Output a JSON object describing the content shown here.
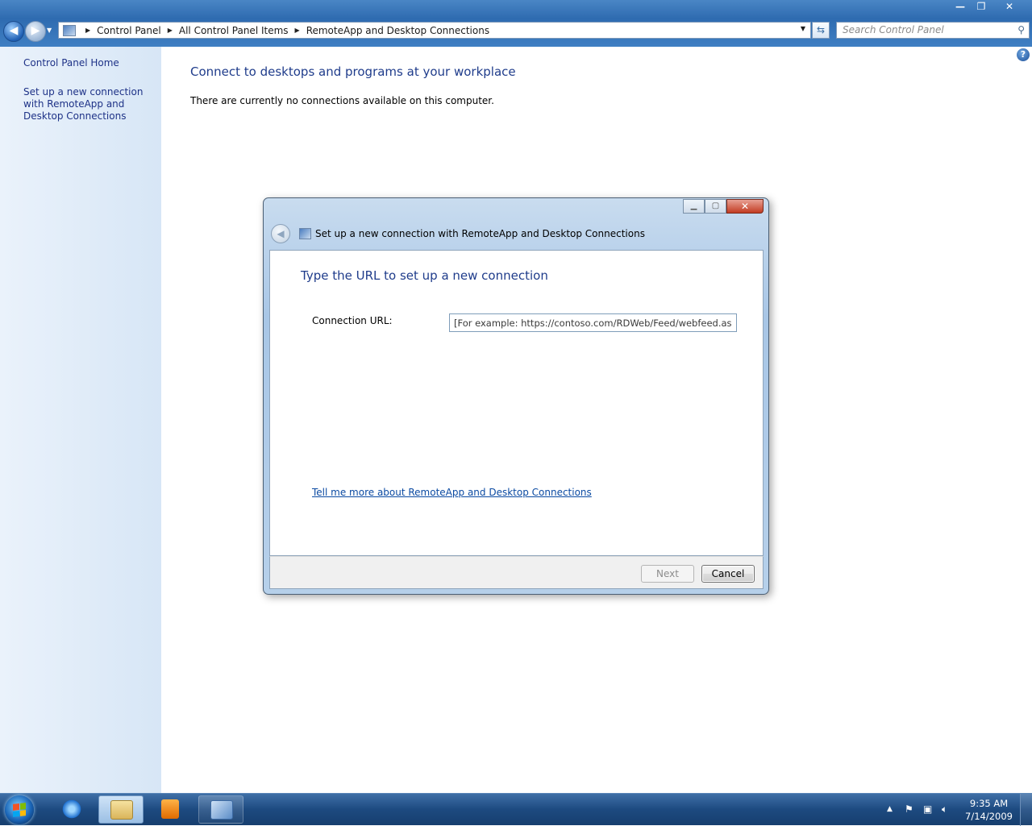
{
  "window": {
    "caption": {
      "minimize": "—",
      "maximize": "❐",
      "close": "✕"
    }
  },
  "nav": {
    "back_icon": "arrow-left-icon",
    "forward_icon": "arrow-right-icon"
  },
  "address": {
    "crumbs": [
      "Control Panel",
      "All Control Panel Items",
      "RemoteApp and Desktop Connections"
    ]
  },
  "search": {
    "placeholder": "Search Control Panel"
  },
  "sidebar": {
    "items": [
      {
        "label": "Control Panel Home"
      },
      {
        "label": "Set up a new connection with RemoteApp and Desktop Connections"
      }
    ]
  },
  "main": {
    "heading": "Connect to desktops and programs at your workplace",
    "info": "There are currently no connections available on this computer."
  },
  "dialog": {
    "title": "Set up a new connection with RemoteApp and Desktop Connections",
    "heading": "Type the URL to set up a new connection",
    "url_label": "Connection URL:",
    "url_value": "[For example: https://contoso.com/RDWeb/Feed/webfeed.aspx]",
    "more_link": "Tell me more about RemoteApp and Desktop Connections",
    "next_label": "Next",
    "cancel_label": "Cancel"
  },
  "taskbar": {
    "time": "9:35 AM",
    "date": "7/14/2009"
  },
  "colors": {
    "accent": "#1f3c8b",
    "link": "#0b4aa2"
  }
}
